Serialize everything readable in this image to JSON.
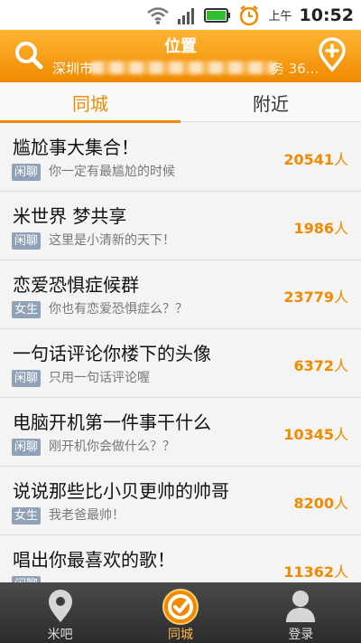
{
  "status_bar": {
    "ampm": "上午",
    "time": "10:52"
  },
  "header": {
    "title": "位置",
    "location_prefix": "深圳市",
    "location_suffix": "务 36..."
  },
  "tabs": [
    {
      "label": "同城",
      "active": true
    },
    {
      "label": "附近",
      "active": false
    }
  ],
  "groups": [
    {
      "title": "尴尬事大集合！",
      "tag": "闲聊",
      "desc": "你一定有最尴尬的时候",
      "count": "20541",
      "unit": "人"
    },
    {
      "title": "米世界 梦共享",
      "tag": "闲聊",
      "desc": "这里是小清新的天下！",
      "count": "1986",
      "unit": "人"
    },
    {
      "title": "恋爱恐惧症候群",
      "tag": "女生",
      "desc": "你也有恋爱恐惧症么？？",
      "count": "23779",
      "unit": "人"
    },
    {
      "title": "一句话评论你楼下的头像",
      "tag": "闲聊",
      "desc": "只用一句话评论喔",
      "count": "6372",
      "unit": "人"
    },
    {
      "title": "电脑开机第一件事干什么",
      "tag": "闲聊",
      "desc": "刚开机你会做什么？？",
      "count": "10345",
      "unit": "人"
    },
    {
      "title": "说说那些比小贝更帅的帅哥",
      "tag": "女生",
      "desc": "我老爸最帅！",
      "count": "8200",
      "unit": "人"
    },
    {
      "title": "唱出你最喜欢的歌！",
      "tag": "闲聊",
      "desc": "",
      "count": "11362",
      "unit": "人"
    }
  ],
  "bottom_nav": [
    {
      "label": "米吧",
      "icon": "location-pin-icon",
      "active": false
    },
    {
      "label": "同城",
      "icon": "target-icon",
      "active": true
    },
    {
      "label": "登录",
      "icon": "person-icon",
      "active": false
    }
  ],
  "colors": {
    "accent": "#f08a00",
    "tag": "#8fa2b8"
  }
}
